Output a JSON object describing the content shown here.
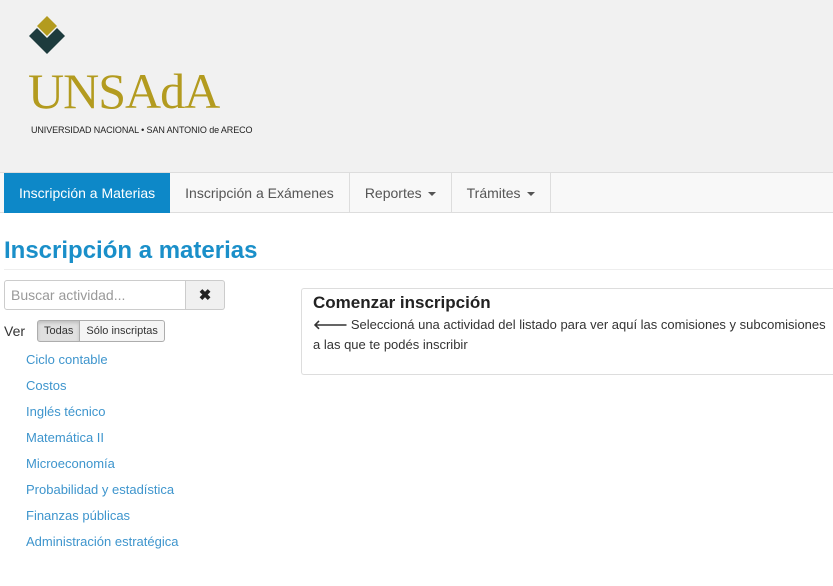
{
  "logo": {
    "wordmark": "UNSAdA",
    "subtitle": "UNIVERSIDAD NACIONAL • SAN ANTONIO de ARECO",
    "colors": {
      "diamond_top": "#b39b1f",
      "diamond_bottom": "#1d3b3d",
      "wordmark": "#b39b1f"
    }
  },
  "nav": {
    "items": [
      {
        "label": "Inscripción a Materias",
        "active": true
      },
      {
        "label": "Inscripción a Exámenes",
        "active": false
      },
      {
        "label": "Reportes",
        "active": false,
        "dropdown": true
      },
      {
        "label": "Trámites",
        "active": false,
        "dropdown": true
      }
    ],
    "active_color": "#0d88c8"
  },
  "page": {
    "title": "Inscripción a materias",
    "title_color": "#1a8fc9"
  },
  "search": {
    "placeholder": "Buscar actividad...",
    "value": "",
    "clear_icon": "close-icon"
  },
  "filter": {
    "label": "Ver",
    "options": [
      "Todas",
      "Sólo inscriptas"
    ],
    "selected": "Todas"
  },
  "activities": [
    "Ciclo contable",
    "Costos",
    "Inglés técnico",
    "Matemática II",
    "Microeconomía",
    "Probabilidad y estadística",
    "Finanzas públicas",
    "Administración estratégica"
  ],
  "panel": {
    "title": "Comenzar inscripción",
    "text": "Seleccioná una actividad del listado para ver aquí las comisiones y subcomisiones a las que te podés inscribir",
    "icon": "arrow-left-icon"
  }
}
